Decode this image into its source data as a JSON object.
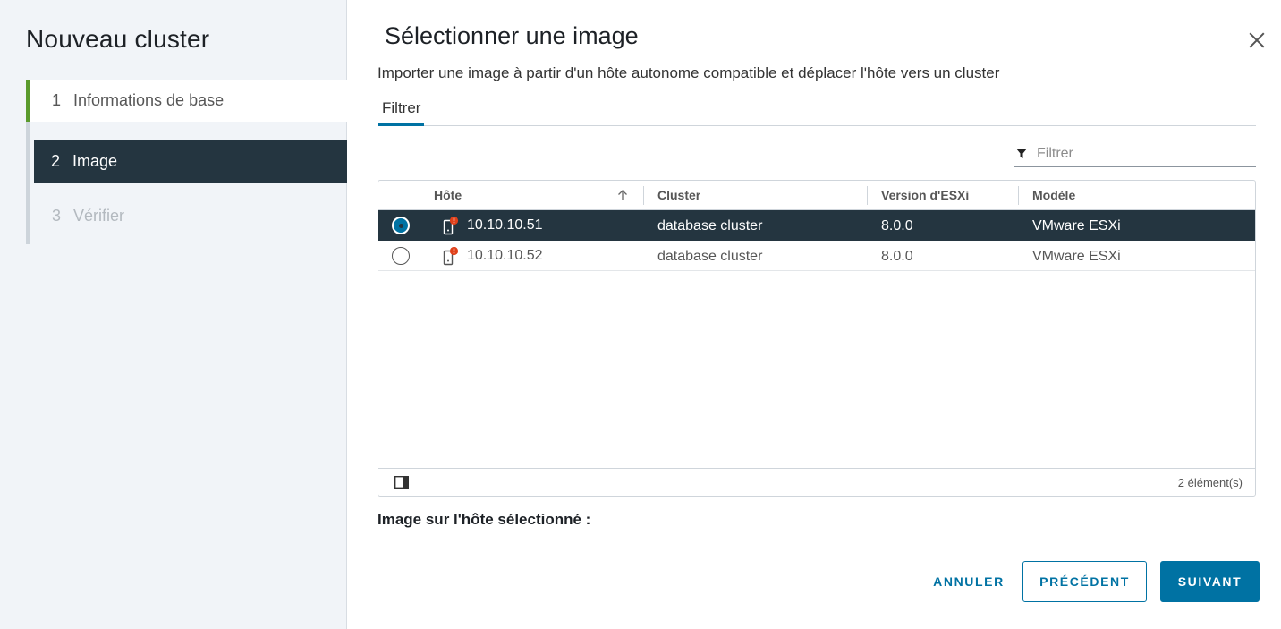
{
  "wizard": {
    "title": "Nouveau cluster",
    "steps": [
      {
        "number": "1",
        "label": "Informations de base",
        "state": "completed"
      },
      {
        "number": "2",
        "label": "Image",
        "state": "active"
      },
      {
        "number": "3",
        "label": "Vérifier",
        "state": "disabled"
      }
    ]
  },
  "main": {
    "title": "Sélectionner une image",
    "subtitle": "Importer une image à partir d'un hôte autonome compatible et déplacer l'hôte vers un cluster",
    "tabs": [
      {
        "label": "Filtrer",
        "active": true
      }
    ],
    "filter": {
      "placeholder": "Filtrer",
      "value": ""
    }
  },
  "grid": {
    "columns": [
      "Hôte",
      "Cluster",
      "Version d'ESXi",
      "Modèle"
    ],
    "sort": {
      "column": "Hôte",
      "direction": "ascending"
    },
    "rows": [
      {
        "host": "10.10.10.51",
        "cluster": "database cluster",
        "version": "8.0.0",
        "model": "VMware ESXi",
        "selected": true
      },
      {
        "host": "10.10.10.52",
        "cluster": "database cluster",
        "version": "8.0.0",
        "model": "VMware ESXi",
        "selected": false
      }
    ],
    "footer": {
      "count": "2 élément(s)"
    }
  },
  "image_label": "Image sur l'hôte sélectionné :",
  "buttons": {
    "cancel": "ANNULER",
    "previous": "PRÉCÉDENT",
    "next": "SUIVANT"
  },
  "colors": {
    "accent": "#0072a3",
    "selected_row": "#243540",
    "completed_step": "#5a9a2c",
    "warning_badge": "#e0401a"
  },
  "icons": {
    "close": "close-icon",
    "filter": "filter-icon",
    "sort": "arrow-up-icon",
    "host": "host-warning-icon",
    "column_toggle": "column-toggle-icon"
  }
}
